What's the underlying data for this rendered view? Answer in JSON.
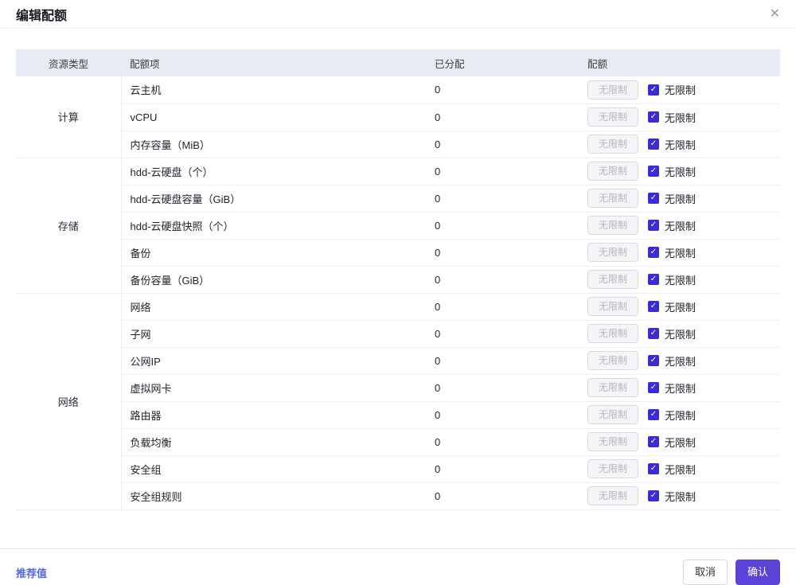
{
  "dialog": {
    "title": "编辑配额"
  },
  "icons": {
    "close": "✕",
    "check": "✓"
  },
  "table": {
    "headers": {
      "resource_type": "资源类型",
      "quota_item": "配额项",
      "allocated": "已分配",
      "quota": "配额"
    },
    "groups": [
      {
        "name": "计算",
        "items": [
          "云主机",
          "vCPU",
          "内存容量（MiB）"
        ]
      },
      {
        "name": "存储",
        "items": [
          "hdd-云硬盘（个）",
          "hdd-云硬盘容量（GiB）",
          "hdd-云硬盘快照（个）",
          "备份",
          "备份容量（GiB）"
        ]
      },
      {
        "name": "网络",
        "items": [
          "网络",
          "子网",
          "公网IP",
          "虚拟网卡",
          "路由器",
          "负载均衡",
          "安全组",
          "安全组规则"
        ]
      }
    ],
    "row_defaults": {
      "allocated": "0",
      "quota_input_placeholder": "无限制",
      "quota_input_value": "",
      "quota_input_disabled": true,
      "unlimited_label": "无限制",
      "unlimited_checked": true
    }
  },
  "footer": {
    "recommended_link": "推荐值",
    "cancel_label": "取消",
    "confirm_label": "确认"
  },
  "colors": {
    "primary": "#5b43d8",
    "checkbox": "#3b2bd4",
    "link": "#5468e6",
    "header_bg": "#e9ebf4"
  }
}
